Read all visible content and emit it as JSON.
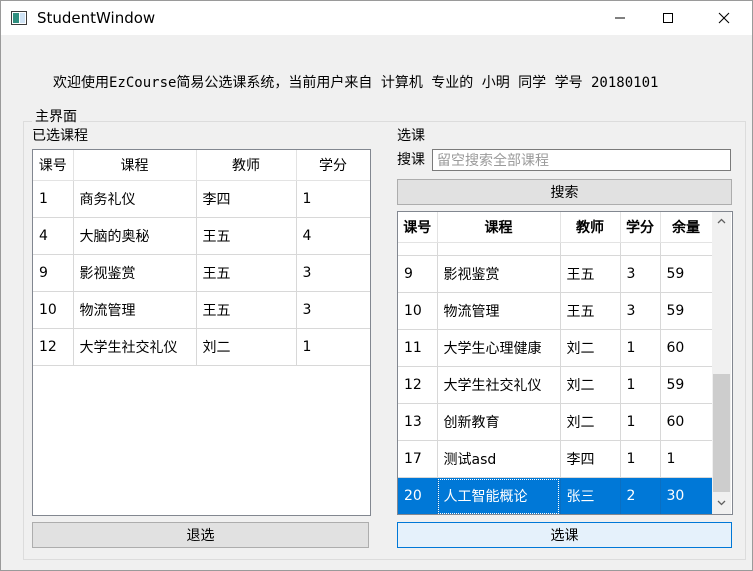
{
  "window": {
    "title": "StudentWindow",
    "minimize_icon": "minimize-icon",
    "maximize_icon": "maximize-icon",
    "close_icon": "close-icon"
  },
  "welcome_text": "欢迎使用EzCourse简易公选课系统，当前用户来自 计算机 专业的 小明 同学 学号 20180101",
  "main_group": {
    "title": "主界面",
    "selected_courses_label": "已选课程",
    "select_label": "选课",
    "search_label": "搜课",
    "search_placeholder": "留空搜索全部课程",
    "search_button": "搜索",
    "drop_button": "退选",
    "enroll_button": "选课"
  },
  "selected_table": {
    "headers": [
      "课号",
      "课程",
      "教师",
      "学分"
    ],
    "rows": [
      [
        "1",
        "商务礼仪",
        "李四",
        "1"
      ],
      [
        "4",
        "大脑的奥秘",
        "王五",
        "4"
      ],
      [
        "9",
        "影视鉴赏",
        "王五",
        "3"
      ],
      [
        "10",
        "物流管理",
        "王五",
        "3"
      ],
      [
        "12",
        "大学生社交礼仪",
        "刘二",
        "1"
      ]
    ]
  },
  "available_table": {
    "headers": [
      "课号",
      "课程",
      "教师",
      "学分",
      "余量"
    ],
    "partial_top_row": [
      "",
      "",
      "",
      "",
      ""
    ],
    "rows": [
      [
        "9",
        "影视鉴赏",
        "王五",
        "3",
        "59"
      ],
      [
        "10",
        "物流管理",
        "王五",
        "3",
        "59"
      ],
      [
        "11",
        "大学生心理健康",
        "刘二",
        "1",
        "60"
      ],
      [
        "12",
        "大学生社交礼仪",
        "刘二",
        "1",
        "59"
      ],
      [
        "13",
        "创新教育",
        "刘二",
        "1",
        "60"
      ],
      [
        "17",
        "测试asd",
        "李四",
        "1",
        "1"
      ],
      [
        "20",
        "人工智能概论",
        "张三",
        "2",
        "30"
      ]
    ],
    "selected_row_index": 6
  },
  "colors": {
    "selection": "#0078d7",
    "window_bg": "#f0f0f0"
  }
}
